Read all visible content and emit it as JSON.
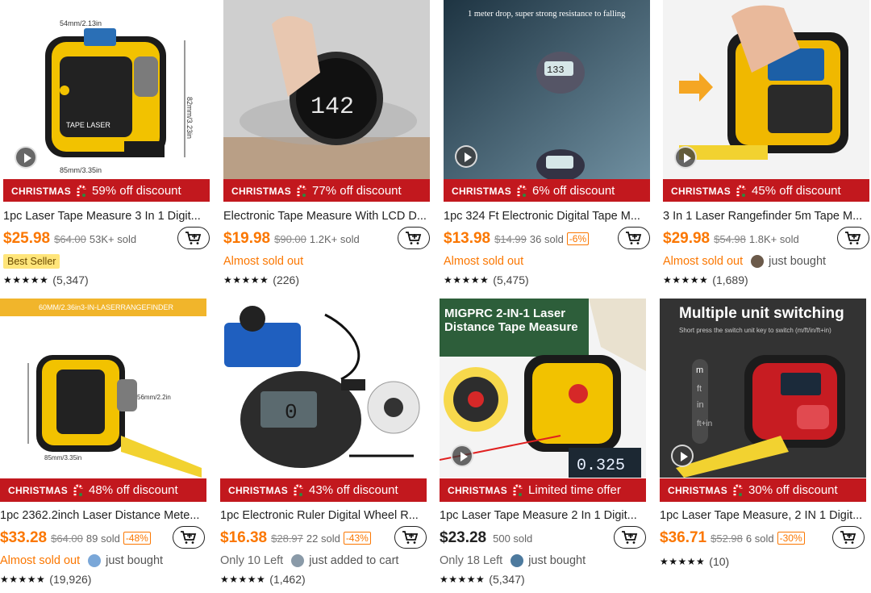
{
  "festive_label": "CHRISTMAS",
  "products": [
    {
      "title": "1pc Laser Tape Measure 3 In 1 Digit...",
      "price": "$25.98",
      "original_price": "$64.00",
      "sold": "53K+ sold",
      "discount_badge": "",
      "banner": "59% off discount",
      "badge": "Best Seller",
      "urgency": "",
      "social": "",
      "rating_stars": "★★★★★",
      "reviews": "(5,347)",
      "has_video": true,
      "price_color": "orange",
      "image_icon": "tape-measure-yellow"
    },
    {
      "title": "Electronic Tape Measure With LCD D...",
      "price": "$19.98",
      "original_price": "$90.00",
      "sold": "1.2K+ sold",
      "discount_badge": "",
      "banner": "77% off discount",
      "badge": "",
      "urgency": "Almost sold out",
      "social": "",
      "rating_stars": "★★★★★",
      "reviews": "(226)",
      "has_video": false,
      "price_color": "orange",
      "image_icon": "wheel-ruler-dark"
    },
    {
      "title": "1pc 324 Ft Electronic Digital Tape M...",
      "price": "$13.98",
      "original_price": "$14.99",
      "sold": "36 sold",
      "discount_badge": "-6%",
      "banner": "6% off discount",
      "badge": "",
      "urgency": "Almost sold out",
      "social": "",
      "rating_stars": "★★★★★",
      "reviews": "(5,475)",
      "has_video": true,
      "price_color": "orange",
      "image_icon": "wheel-ruler-teal",
      "image_caption": "1 meter drop, super strong resistance to falling"
    },
    {
      "title": "3 In 1 Laser Rangefinder 5m Tape M...",
      "price": "$29.98",
      "original_price": "$54.98",
      "sold": "1.8K+ sold",
      "discount_badge": "",
      "banner": "45% off discount",
      "badge": "",
      "urgency": "Almost sold out",
      "social": "just bought",
      "rating_stars": "★★★★★",
      "reviews": "(1,689)",
      "has_video": true,
      "price_color": "orange",
      "image_icon": "tape-measure-hand"
    },
    {
      "title": "1pc 2362.2inch Laser Distance Mete...",
      "price": "$33.28",
      "original_price": "$64.00",
      "sold": "89 sold",
      "discount_badge": "-48%",
      "banner": "48% off discount",
      "badge": "",
      "urgency": "Almost sold out",
      "social": "just bought",
      "rating_stars": "★★★★★",
      "reviews": "(19,926)",
      "has_video": false,
      "price_color": "orange",
      "image_icon": "tape-measure-yellow-2",
      "image_caption": "60MM/2.36in3-IN-LASERRANGEFINDER"
    },
    {
      "title": "1pc Electronic Ruler Digital Wheel R...",
      "price": "$16.38",
      "original_price": "$28.97",
      "sold": "22 sold",
      "discount_badge": "-43%",
      "banner": "43% off discount",
      "badge": "",
      "urgency": "",
      "stock": "Only 10 Left",
      "social": "just added to cart",
      "rating_stars": "★★★★★",
      "reviews": "(1,462)",
      "has_video": false,
      "price_color": "orange",
      "image_icon": "wheel-ruler-kit"
    },
    {
      "title": "1pc Laser Tape Measure 2 In 1 Digit...",
      "price": "$23.28",
      "original_price": "",
      "sold": "500 sold",
      "discount_badge": "",
      "banner": "Limited time offer",
      "badge": "",
      "urgency": "",
      "stock": "Only 18 Left",
      "social": "just bought",
      "rating_stars": "★★★★★",
      "reviews": "(5,347)",
      "has_video": true,
      "price_color": "black",
      "image_icon": "laser-tape-gloves",
      "image_caption": "MIGPRC 2-IN-1 Laser Distance Tape Measure"
    },
    {
      "title": "1pc Laser Tape Measure, 2 IN 1 Digit...",
      "price": "$36.71",
      "original_price": "$52.98",
      "sold": "6 sold",
      "discount_badge": "-30%",
      "banner": "30% off discount",
      "badge": "",
      "urgency": "",
      "social": "",
      "rating_stars": "★★★★★",
      "reviews": "(10)",
      "has_video": true,
      "price_color": "orange",
      "image_icon": "tape-measure-red",
      "image_caption": "Multiple unit switching",
      "image_subcaption": "Short press the switch unit key to switch (m/ft/in/ft+in)"
    }
  ]
}
